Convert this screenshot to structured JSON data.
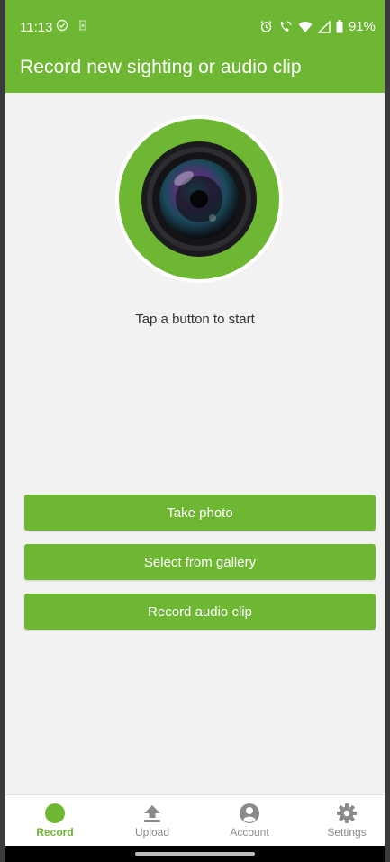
{
  "status_bar": {
    "time": "11:13",
    "battery": "91%"
  },
  "app_bar": {
    "title": "Record new sighting or audio clip"
  },
  "hero": {
    "icon": "camera-lens-icon"
  },
  "hint": "Tap a button to start",
  "actions": {
    "take_photo": "Take photo",
    "select_gallery": "Select from gallery",
    "record_audio": "Record audio clip"
  },
  "bottom_nav": {
    "items": [
      {
        "label": "Record",
        "icon": "record-circle-icon",
        "active": true
      },
      {
        "label": "Upload",
        "icon": "upload-icon",
        "active": false
      },
      {
        "label": "Account",
        "icon": "account-icon",
        "active": false
      },
      {
        "label": "Settings",
        "icon": "gear-icon",
        "active": false
      }
    ]
  },
  "colors": {
    "accent": "#6db733",
    "background": "#f2f2f2"
  }
}
